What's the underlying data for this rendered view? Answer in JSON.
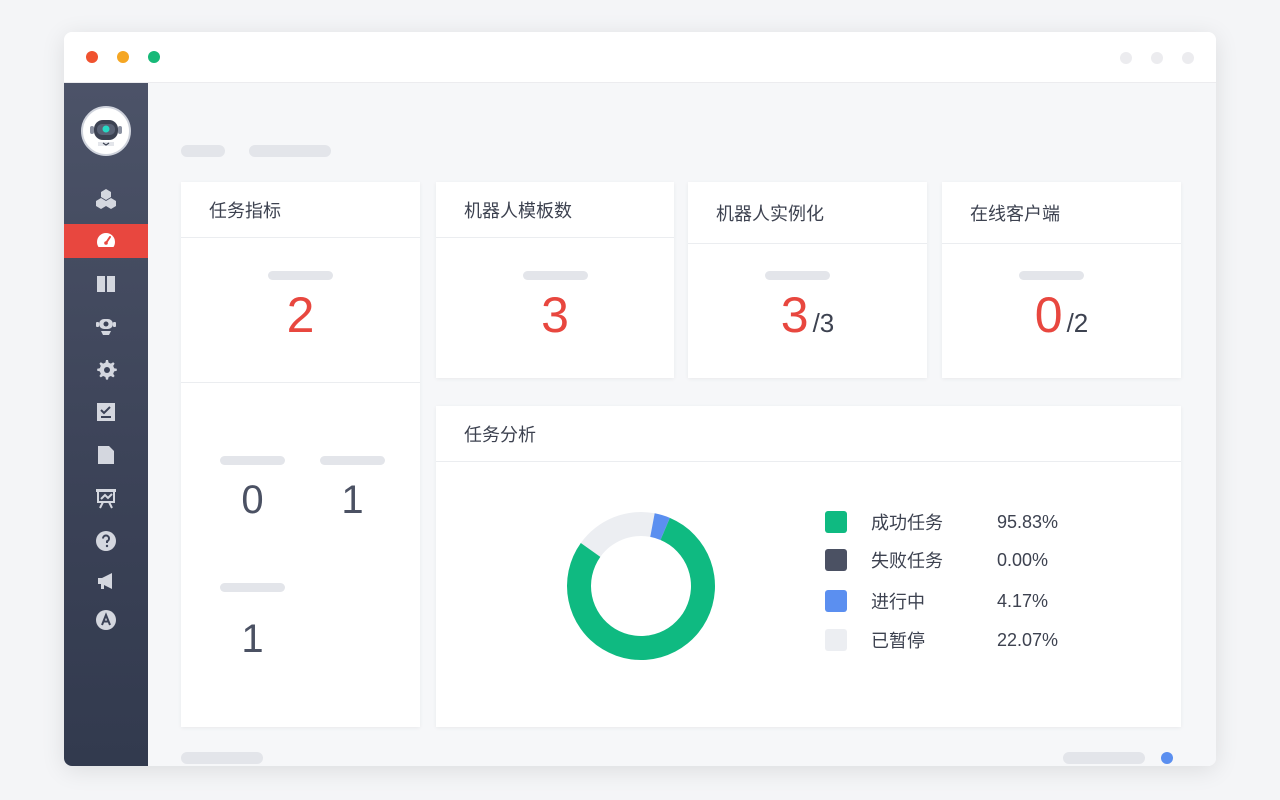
{
  "window": {
    "traffic_lights": {
      "close": "#f0522f",
      "minimize": "#f5a623",
      "maximize": "#17b978"
    }
  },
  "sidebar": {
    "active_color": "#e8473f",
    "items": [
      {
        "icon": "cubes-icon",
        "active": false
      },
      {
        "icon": "dashboard-gauge-icon",
        "active": true
      },
      {
        "icon": "book-icon",
        "active": false
      },
      {
        "icon": "robot-icon",
        "active": false
      },
      {
        "icon": "gear-icon",
        "active": false
      },
      {
        "icon": "checklist-icon",
        "active": false
      },
      {
        "icon": "document-icon",
        "active": false
      },
      {
        "icon": "presentation-chart-icon",
        "active": false
      },
      {
        "icon": "help-icon",
        "active": false
      },
      {
        "icon": "megaphone-icon",
        "active": false
      },
      {
        "icon": "language-icon",
        "active": false
      }
    ]
  },
  "cards": {
    "task_metrics": {
      "title": "任务指标",
      "total": "2",
      "sub_a": "0",
      "sub_b": "1",
      "sub_c": "1"
    },
    "robot_templates": {
      "title": "机器人模板数",
      "value": "3"
    },
    "robot_instances": {
      "title": "机器人实例化",
      "value": "3",
      "total": "/3"
    },
    "online_clients": {
      "title": "在线客户端",
      "value": "0",
      "total": "/2"
    }
  },
  "task_analysis": {
    "title": "任务分析",
    "legend": [
      {
        "label": "成功任务",
        "pct": "95.83%",
        "color": "#0fba81"
      },
      {
        "label": "失败任务",
        "pct": "0.00%",
        "color": "#4b5163"
      },
      {
        "label": "进行中",
        "pct": "4.17%",
        "color": "#5b8ff0"
      },
      {
        "label": "已暂停",
        "pct": "22.07%",
        "color": "#eceef2"
      }
    ]
  },
  "footer": {
    "dot_color": "#5b8ff0"
  }
}
